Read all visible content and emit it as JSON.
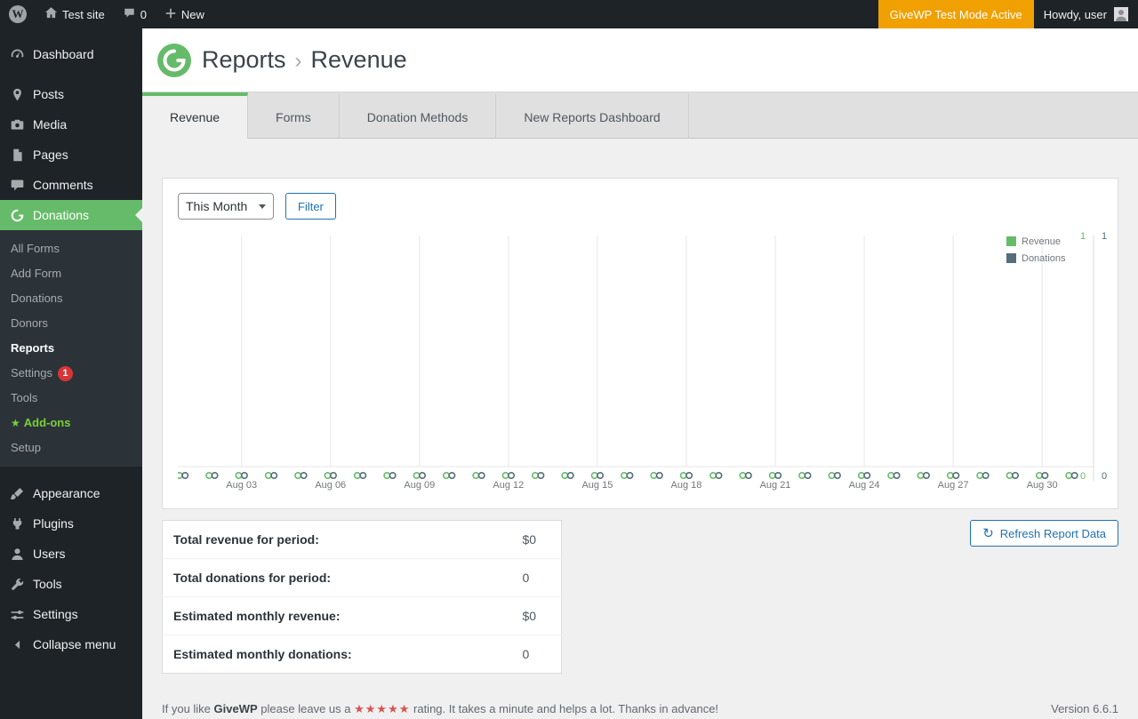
{
  "colors": {
    "brand": "#66bb6a",
    "test_mode_bg": "#f0a000",
    "link_blue": "#2271b1",
    "badge_red": "#d63638",
    "addons_green": "#7ad03a",
    "star_red": "#d9534f"
  },
  "admin_bar": {
    "site_name": "Test site",
    "comments_count": "0",
    "new_label": "New",
    "test_mode_label": "GiveWP Test Mode Active",
    "howdy_label": "Howdy, user",
    "wp_logo_letter": "W"
  },
  "sidebar": {
    "items": [
      {
        "label": "Dashboard"
      },
      {
        "label": "Posts"
      },
      {
        "label": "Media"
      },
      {
        "label": "Pages"
      },
      {
        "label": "Comments"
      },
      {
        "label": "Donations"
      },
      {
        "label": "Appearance"
      },
      {
        "label": "Plugins"
      },
      {
        "label": "Users"
      },
      {
        "label": "Tools"
      },
      {
        "label": "Settings"
      }
    ],
    "submenu": [
      {
        "label": "All Forms"
      },
      {
        "label": "Add Form"
      },
      {
        "label": "Donations"
      },
      {
        "label": "Donors"
      },
      {
        "label": "Reports"
      },
      {
        "label": "Settings",
        "badge": "1"
      },
      {
        "label": "Tools"
      },
      {
        "label": "Add-ons",
        "star": "★"
      },
      {
        "label": "Setup"
      }
    ],
    "collapse_label": "Collapse menu"
  },
  "header": {
    "section": "Reports",
    "separator": "›",
    "page": "Revenue"
  },
  "tabs": [
    {
      "label": "Revenue"
    },
    {
      "label": "Forms"
    },
    {
      "label": "Donation Methods"
    },
    {
      "label": "New Reports Dashboard"
    }
  ],
  "filter": {
    "period_value": "This Month",
    "button_label": "Filter"
  },
  "chart_data": {
    "type": "line",
    "title": "",
    "x": [
      "Aug 01",
      "Aug 02",
      "Aug 03",
      "Aug 04",
      "Aug 05",
      "Aug 06",
      "Aug 07",
      "Aug 08",
      "Aug 09",
      "Aug 10",
      "Aug 11",
      "Aug 12",
      "Aug 13",
      "Aug 14",
      "Aug 15",
      "Aug 16",
      "Aug 17",
      "Aug 18",
      "Aug 19",
      "Aug 20",
      "Aug 21",
      "Aug 22",
      "Aug 23",
      "Aug 24",
      "Aug 25",
      "Aug 26",
      "Aug 27",
      "Aug 28",
      "Aug 29",
      "Aug 30",
      "Aug 31"
    ],
    "x_ticks": [
      "Aug 03",
      "Aug 06",
      "Aug 09",
      "Aug 12",
      "Aug 15",
      "Aug 18",
      "Aug 21",
      "Aug 24",
      "Aug 27",
      "Aug 30"
    ],
    "series": [
      {
        "name": "Revenue",
        "color": "#66bb6a",
        "axis": {
          "min": 0,
          "max": 1
        },
        "values": [
          0,
          0,
          0,
          0,
          0,
          0,
          0,
          0,
          0,
          0,
          0,
          0,
          0,
          0,
          0,
          0,
          0,
          0,
          0,
          0,
          0,
          0,
          0,
          0,
          0,
          0,
          0,
          0,
          0,
          0,
          0
        ]
      },
      {
        "name": "Donations",
        "color": "#556e79",
        "axis": {
          "min": 0,
          "max": 1
        },
        "values": [
          0,
          0,
          0,
          0,
          0,
          0,
          0,
          0,
          0,
          0,
          0,
          0,
          0,
          0,
          0,
          0,
          0,
          0,
          0,
          0,
          0,
          0,
          0,
          0,
          0,
          0,
          0,
          0,
          0,
          0,
          0
        ]
      }
    ],
    "legend_position": "top-right",
    "grid": "vertical"
  },
  "summary": {
    "rows": [
      {
        "label": "Total revenue for period:",
        "value": "$0"
      },
      {
        "label": "Total donations for period:",
        "value": "0"
      },
      {
        "label": "Estimated monthly revenue:",
        "value": "$0"
      },
      {
        "label": "Estimated monthly donations:",
        "value": "0"
      }
    ]
  },
  "refresh_button_label": "Refresh Report Data",
  "footer": {
    "text_before": "If you like",
    "brand": "GiveWP",
    "text_mid": "please leave us a",
    "stars": "★★★★★",
    "text_after": "rating. It takes a minute and helps a lot. Thanks in advance!",
    "version": "Version 6.6.1"
  }
}
